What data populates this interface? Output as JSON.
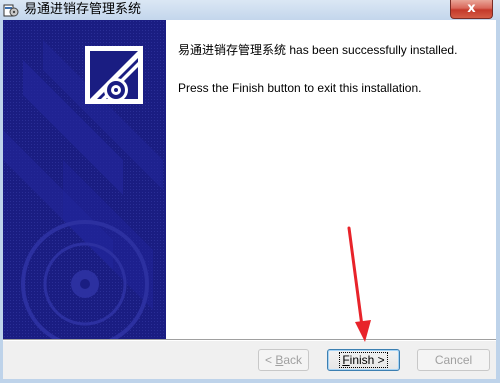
{
  "window": {
    "title": "易通进销存管理系统",
    "close_label": "x"
  },
  "content": {
    "app_name": "易通进销存管理系统",
    "installed_suffix": " has been successfully installed.",
    "instruction": "Press the Finish button to exit this installation."
  },
  "buttons": {
    "back_prefix": "< ",
    "back_key": "B",
    "back_rest": "ack",
    "finish_prefix": "",
    "finish_key": "F",
    "finish_rest": "inish >",
    "cancel": "Cancel"
  },
  "colors": {
    "banner": "#1a1d82",
    "annotation_arrow": "#e8232a"
  }
}
